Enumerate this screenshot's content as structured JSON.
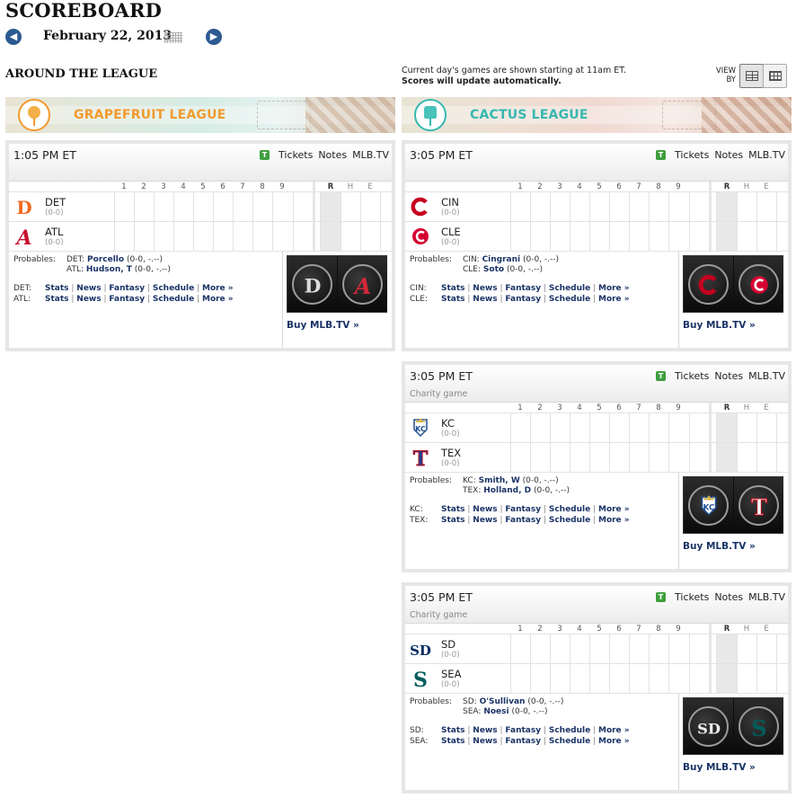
{
  "page": {
    "title": "SCOREBOARD",
    "date": "February 22, 2013",
    "section": "AROUND THE LEAGUE"
  },
  "notice": {
    "line1": "Current day's games are shown starting at 11am ET.",
    "line2": "Scores will update automatically."
  },
  "viewby": {
    "label_top": "VIEW",
    "label_bottom": "BY"
  },
  "leagues": {
    "grapefruit": "GRAPEFRUIT LEAGUE",
    "cactus": "CACTUS LEAGUE"
  },
  "linescore_headers": {
    "innings": [
      "1",
      "2",
      "3",
      "4",
      "5",
      "6",
      "7",
      "8",
      "9"
    ],
    "totals": [
      "R",
      "H",
      "E"
    ]
  },
  "header_links": {
    "tickets": "Tickets",
    "notes": "Notes",
    "mlbtv": "MLB.TV"
  },
  "info_labels": {
    "probables": "Probables:",
    "buy": "Buy MLB.TV »",
    "links": [
      "Stats",
      "News",
      "Fantasy",
      "Schedule",
      "More »"
    ]
  },
  "games": [
    {
      "time": "1:05 PM ET",
      "note": "",
      "away": {
        "abbr": "DET",
        "record": "(0-0)",
        "color": "#f26a21",
        "icon": "tigers-logo-icon",
        "probable_label": "DET:",
        "pitcher": "Porcello",
        "pitcher_record": "(0-0, -.--)"
      },
      "home": {
        "abbr": "ATL",
        "record": "(0-0)",
        "color": "#c8102e",
        "icon": "braves-logo-icon",
        "probable_label": "ATL:",
        "pitcher": "Hudson, T",
        "pitcher_record": "(0-0, -.--)"
      }
    },
    {
      "time": "3:05 PM ET",
      "note": "",
      "away": {
        "abbr": "CIN",
        "record": "(0-0)",
        "color": "#c6011f",
        "icon": "reds-logo-icon",
        "probable_label": "CIN:",
        "pitcher": "Cingrani",
        "pitcher_record": "(0-0, -.--)"
      },
      "home": {
        "abbr": "CLE",
        "record": "(0-0)",
        "color": "#d50032",
        "icon": "indians-logo-icon",
        "probable_label": "CLE:",
        "pitcher": "Soto",
        "pitcher_record": "(0-0, -.--)"
      }
    },
    {
      "time": "3:05 PM ET",
      "note": "Charity game",
      "away": {
        "abbr": "KC",
        "record": "(0-0)",
        "color": "#1f4e94",
        "icon": "royals-logo-icon",
        "probable_label": "KC:",
        "pitcher": "Smith, W",
        "pitcher_record": "(0-0, -.--)"
      },
      "home": {
        "abbr": "TEX",
        "record": "(0-0)",
        "color": "#c0111f",
        "icon": "rangers-logo-icon",
        "probable_label": "TEX:",
        "pitcher": "Holland, D",
        "pitcher_record": "(0-0, -.--)"
      }
    },
    {
      "time": "3:05 PM ET",
      "note": "Charity game",
      "away": {
        "abbr": "SD",
        "record": "(0-0)",
        "color": "#002d62",
        "icon": "padres-logo-icon",
        "probable_label": "SD:",
        "pitcher": "O'Sullivan",
        "pitcher_record": "(0-0, -.--)"
      },
      "home": {
        "abbr": "SEA",
        "record": "(0-0)",
        "color": "#005c5c",
        "icon": "mariners-logo-icon",
        "probable_label": "SEA:",
        "pitcher": "Noesi",
        "pitcher_record": "(0-0, -.--)"
      }
    }
  ]
}
